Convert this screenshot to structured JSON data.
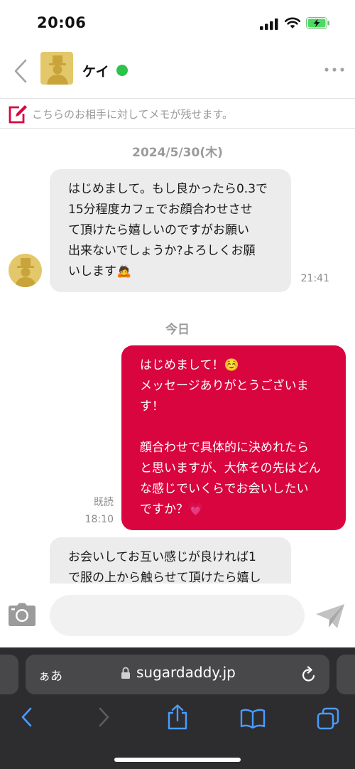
{
  "status_bar": {
    "time": "20:06"
  },
  "header": {
    "contact_name": "ケイ"
  },
  "memo": {
    "placeholder": "こちらのお相手に対してメモが残せます。"
  },
  "chat": {
    "date_1": "2024/5/30(木)",
    "msg_1": {
      "text": "はじめまして。もし良かったら0.3で\n15分程度カフェでお顔合わせさせ\nて頂けたら嬉しいのですがお願い\n出来ないでしょうか?よろしくお願\nいします🙇",
      "time": "21:41"
    },
    "date_2": "今日",
    "msg_2": {
      "text": "はじめまして！☺️\nメッセージありがとうございま\nす！\n\n顔合わせで具体的に決めれたら\nと思いますが、大体その先はどん\nな感じでいくらでお会いしたい\nですか？💗",
      "read": "既読",
      "time": "18:10"
    },
    "msg_3": {
      "text": "お会いしてお互い感じが良ければ1\nで服の上から触らせて頂けたら嬉し"
    }
  },
  "composer": {
    "input_value": ""
  },
  "browser": {
    "aa_label": "ぁあ",
    "url": "sugardaddy.jp"
  },
  "colors": {
    "accent": "#d8053f",
    "online": "#2ec24a",
    "incoming_bubble": "#ececec"
  }
}
